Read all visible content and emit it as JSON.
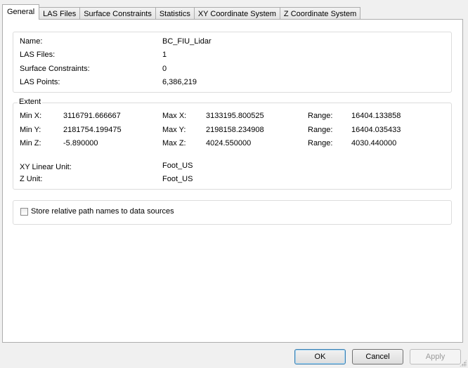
{
  "tabs": [
    "General",
    "LAS Files",
    "Surface Constraints",
    "Statistics",
    "XY Coordinate System",
    "Z Coordinate System"
  ],
  "info": {
    "name_label": "Name:",
    "name_value": "BC_FIU_Lidar",
    "las_files_label": "LAS Files:",
    "las_files_value": "1",
    "surface_constraints_label": "Surface Constraints:",
    "surface_constraints_value": "0",
    "las_points_label": "LAS Points:",
    "las_points_value": "6,386,219"
  },
  "extent": {
    "legend": "Extent",
    "min_x_label": "Min X:",
    "min_x": "3116791.666667",
    "max_x_label": "Max X:",
    "max_x": "3133195.800525",
    "range_x_label": "Range:",
    "range_x": "16404.133858",
    "min_y_label": "Min Y:",
    "min_y": "2181754.199475",
    "max_y_label": "Max Y:",
    "max_y": "2198158.234908",
    "range_y_label": "Range:",
    "range_y": "16404.035433",
    "min_z_label": "Min Z:",
    "min_z": "-5.890000",
    "max_z_label": "Max Z:",
    "max_z": "4024.550000",
    "range_z_label": "Range:",
    "range_z": "4030.440000",
    "xy_unit_label": "XY Linear Unit:",
    "xy_unit": "Foot_US",
    "z_unit_label": "Z Unit:",
    "z_unit": "Foot_US"
  },
  "options": {
    "store_relative_label": "Store relative path names to data sources",
    "store_relative_checked": false
  },
  "buttons": {
    "ok": "OK",
    "cancel": "Cancel",
    "apply": "Apply"
  }
}
